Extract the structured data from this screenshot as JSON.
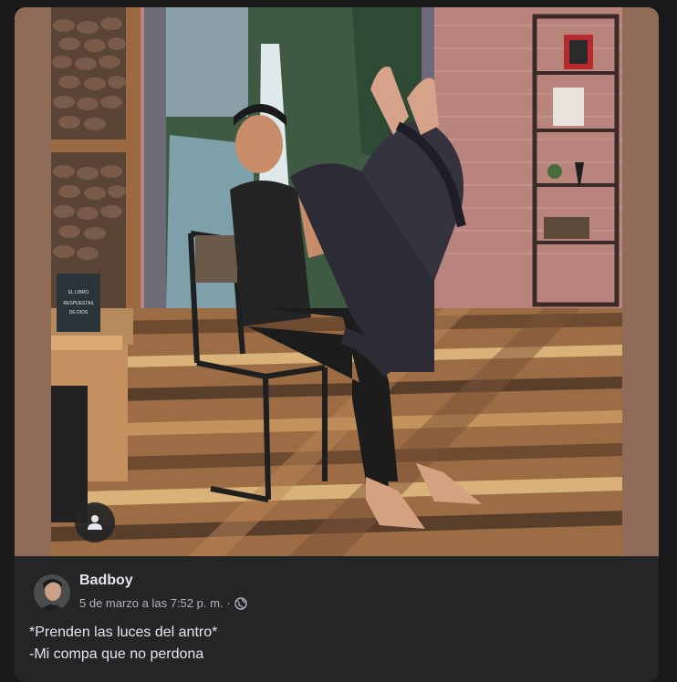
{
  "post": {
    "author": "Badboy",
    "timestamp": "5 de marzo a las 7:52 p. m.",
    "separator": "·",
    "privacy_icon": "globe-icon",
    "caption_lines": [
      "*Prenden las luces del antro*",
      "-Mi compa que no perdona"
    ]
  },
  "photo_overlay": {
    "badge_icon": "person-icon"
  },
  "book_cover": {
    "line1": "EL LIBRO",
    "line2": "RESPUESTAS",
    "line3": "DE DIOS"
  },
  "colors": {
    "card_bg": "#242526",
    "page_bg": "#18191a",
    "primary_text": "#e4e6eb",
    "secondary_text": "#b0b3b8",
    "frame_bg": "#8f6b58"
  }
}
